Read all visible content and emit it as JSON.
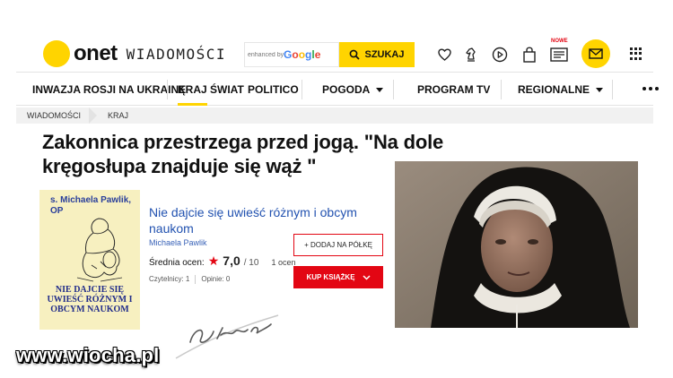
{
  "header": {
    "logo_text": "onet",
    "section_name": "WIADOMOŚCI",
    "search": {
      "placeholder": "enhanced by",
      "brand": "Google",
      "button_label": "SZUKAJ"
    },
    "icons": [
      "heart-icon",
      "chess-knight-icon",
      "play-icon",
      "shopping-bag-icon",
      "newspaper-icon",
      "mail-icon",
      "apps-grid-icon"
    ],
    "new_badge": "NOWE",
    "accent_color": "#ffd400"
  },
  "nav": {
    "items": [
      {
        "label": "INWAZJA ROSJI NA UKRAINĘ"
      },
      {
        "label": "KRAJ",
        "active": true
      },
      {
        "label": "ŚWIAT"
      },
      {
        "label": "POLITICO"
      },
      {
        "label": "POGODA",
        "dropdown": true
      },
      {
        "label": "PROGRAM TV"
      },
      {
        "label": "REGIONALNE",
        "dropdown": true
      }
    ],
    "more": "more-dots-icon"
  },
  "breadcrumb": [
    {
      "label": "WIADOMOŚCI"
    },
    {
      "label": "KRAJ"
    }
  ],
  "article": {
    "title": "Zakonnica przestrzega przed jogą. \"Na dole kręgosłupa znajduje się wąż \""
  },
  "book": {
    "cover_author": "s. Michaela Pawlik, OP",
    "cover_title": "NIE DAJCIE SIĘ UWIEŚĆ RÓŻNYM I OBCYM NAUKOM",
    "title": "Nie dajcie się uwieść różnym i obcym naukom",
    "author": "Michaela Pawlik",
    "rating_label": "Średnia ocen:",
    "rating_value": "7,0",
    "rating_scale": "/ 10",
    "rating_count": "1 ocen",
    "readers": "Czytelnicy: 1",
    "opinions": "Opinie: 0",
    "shelf_button": "+ DODAJ NA PÓŁKĘ",
    "buy_button": "KUP KSIĄŻKĘ",
    "brand_red": "#e30613"
  },
  "watermark": {
    "signature": "Bitzer",
    "site": "www.wiocha.pl"
  }
}
